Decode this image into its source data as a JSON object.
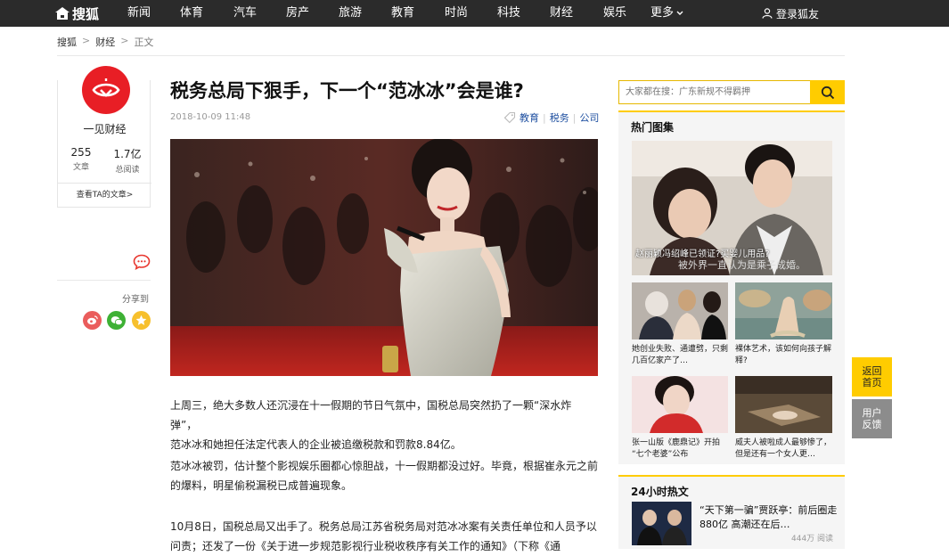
{
  "topnav": {
    "logo": "搜狐",
    "items": [
      "新闻",
      "体育",
      "汽车",
      "房产",
      "旅游",
      "教育",
      "时尚",
      "科技",
      "财经",
      "娱乐",
      "更多"
    ],
    "login": "登录狐友"
  },
  "breadcrumb": [
    "搜狐",
    "财经",
    "正文"
  ],
  "author": {
    "name": "一见财经",
    "articles_count": "255",
    "articles_label": "文章",
    "views_count": "1.7亿",
    "views_label": "总阅读",
    "link": "查看TA的文章>"
  },
  "share": {
    "label": "分享到",
    "icons": [
      "weibo-icon",
      "wechat-icon",
      "qzone-icon"
    ]
  },
  "article": {
    "title": "税务总局下狠手，下一个“范冰冰”会是谁?",
    "date": "2018-10-09 11:48",
    "tags": [
      "教育",
      "税务",
      "公司"
    ],
    "paragraphs": [
      [
        "上周三，绝大多数人还沉浸在十一假期的节日气氛中，国税总局突然扔了一颗“深水炸弹”，",
        "范冰冰和她担任法定代表人的企业被追缴税款和罚款8.84亿。"
      ],
      [
        "范冰冰被罚，估计整个影视娱乐圈都心惊胆战，十一假期都没过好。毕竟，根据崔永元之前",
        "的爆料，明星偷税漏税已成普遍现象。"
      ],
      [
        "10月8日，国税总局又出手了。税务总局江苏省税务局对范冰冰案有关责任单位和人员予以",
        "问责；还发了一份《关于进一步规范影视行业税收秩序有关工作的通知》（下称《通"
      ]
    ]
  },
  "search": {
    "placeholder": "大家都在搜：广东新规不得羁押"
  },
  "hot_gallery": {
    "title": "热门图集",
    "featured": {
      "caption": "赵丽颖冯绍峰已领证?买婴儿用品?",
      "subtitle": "被外界一直认为是乘子成婚。"
    },
    "items": [
      {
        "caption": [
          "她创业失败、通遭劈，只剩",
          "几百亿家产了…"
        ]
      },
      {
        "caption": [
          "裸体艺术，该如何向孩子解",
          "释?"
        ]
      },
      {
        "caption": [
          "张一山版《鹿鼎记》开拍",
          "“七个老婆”公布"
        ]
      },
      {
        "caption": [
          "威夫人被啦成人最够惨了，",
          "但是还有一个女人更…"
        ]
      }
    ]
  },
  "hot_24h": {
    "title": "24小时热文",
    "items": [
      {
        "title": [
          "“天下第一骗”贾跃亭：前后圈走",
          "880亿 高潮还在后…"
        ],
        "reads": "444万 阅读"
      }
    ]
  },
  "float": {
    "back_top": [
      "返回",
      "首页"
    ],
    "feedback": [
      "用户",
      "反馈"
    ]
  },
  "colors": {
    "nav_bg": "#2b2b2b",
    "accent": "#ffcc00",
    "link": "#1e4fa0",
    "brand_red": "#e81e25"
  }
}
